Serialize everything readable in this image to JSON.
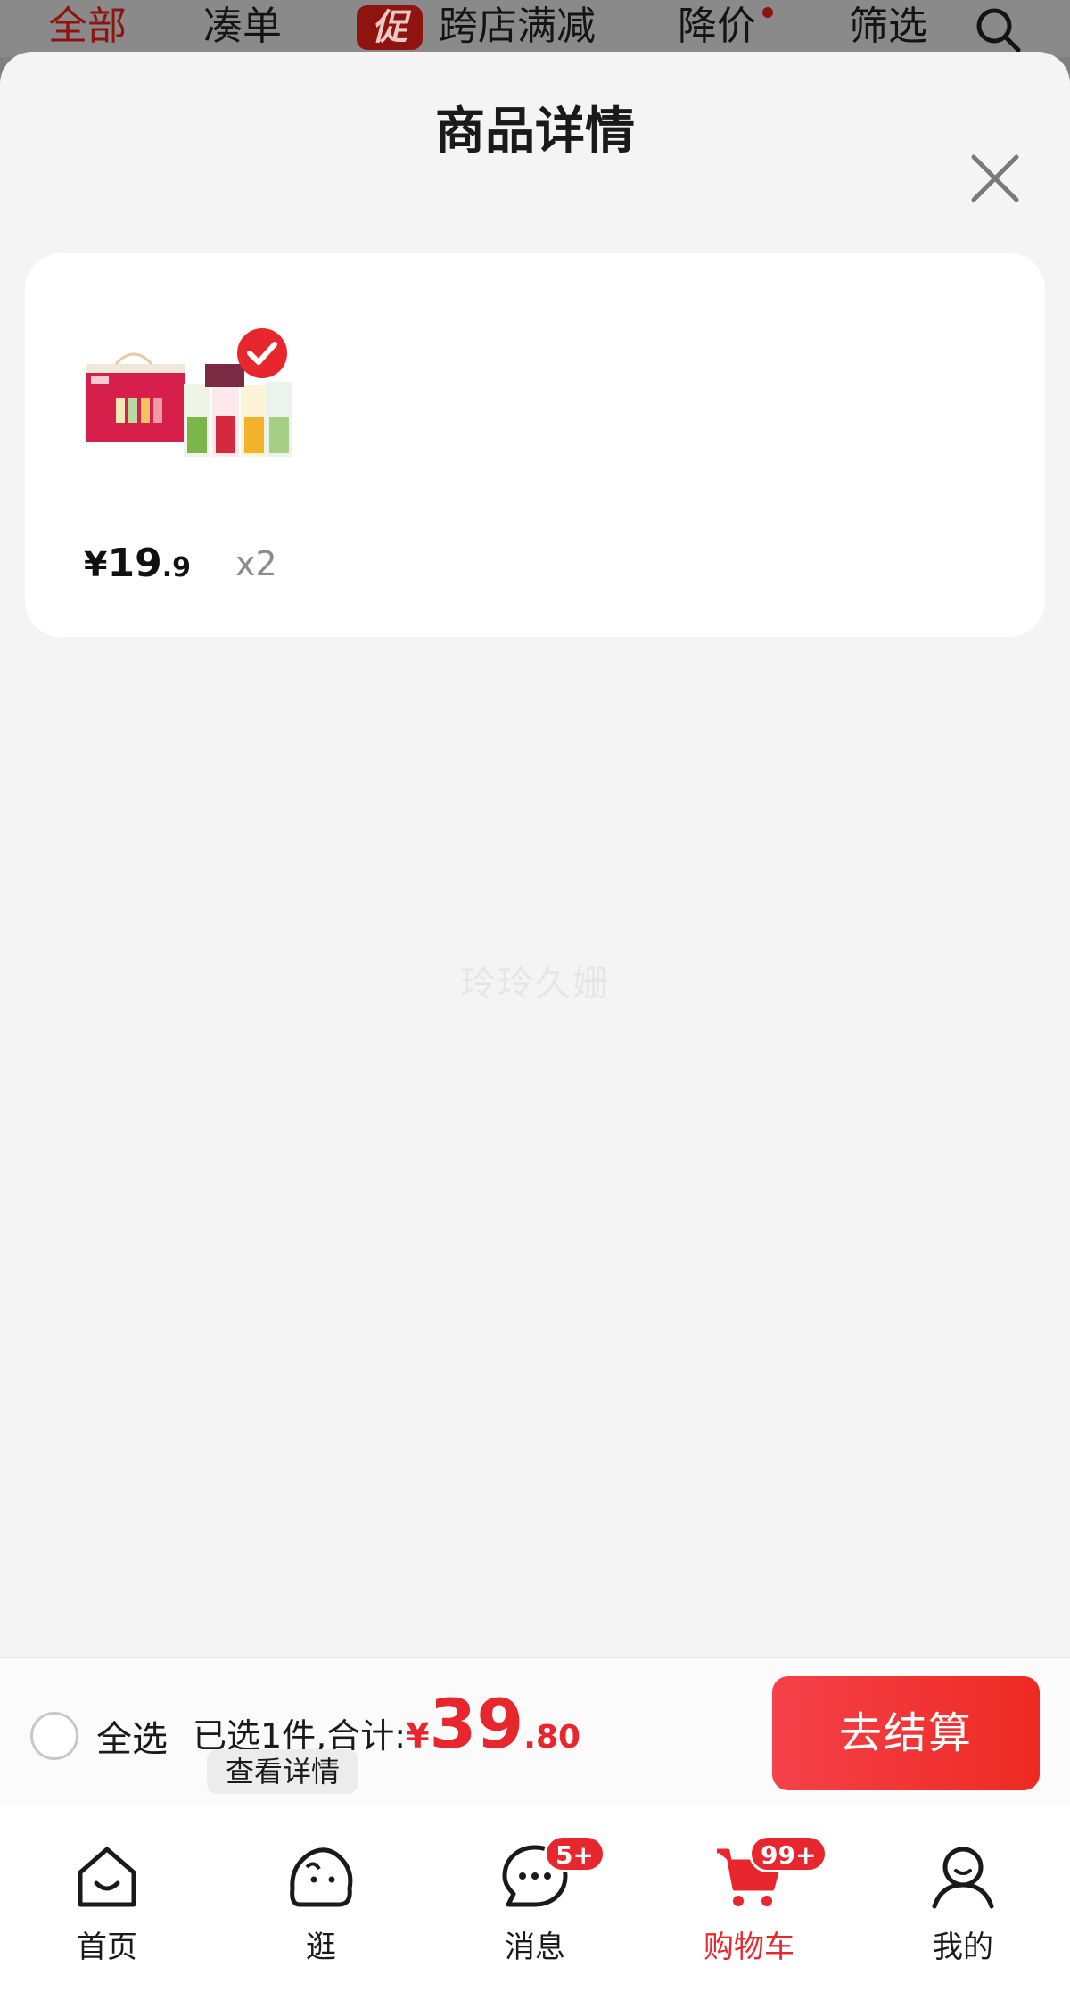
{
  "top_filters": {
    "all": "全部",
    "bundle": "凑单",
    "promo_badge": "促",
    "cross_store": "跨店满减",
    "price_drop": "降价",
    "filter": "筛选"
  },
  "sheet": {
    "title": "商品详情"
  },
  "item": {
    "price_currency": "¥",
    "price_integer": "19",
    "price_decimal": ".9",
    "quantity": "x2"
  },
  "watermark": "玲玲久姗",
  "checkout": {
    "select_all": "全选",
    "summary_label": "已选1件,合计:",
    "total_currency": "¥",
    "total_integer": "39",
    "total_decimal": ".80",
    "details_link": "查看详情",
    "checkout_button": "去结算"
  },
  "tabs": [
    {
      "label": "首页",
      "icon": "home-icon"
    },
    {
      "label": "逛",
      "icon": "browse-icon"
    },
    {
      "label": "消息",
      "icon": "message-icon",
      "badge": "5+"
    },
    {
      "label": "购物车",
      "icon": "cart-icon",
      "badge": "99+",
      "active": true
    },
    {
      "label": "我的",
      "icon": "profile-icon"
    }
  ],
  "colors": {
    "accent_red": "#e8262d",
    "sheet_bg": "#f4f4f4",
    "overlay": "#7f7f7f"
  }
}
